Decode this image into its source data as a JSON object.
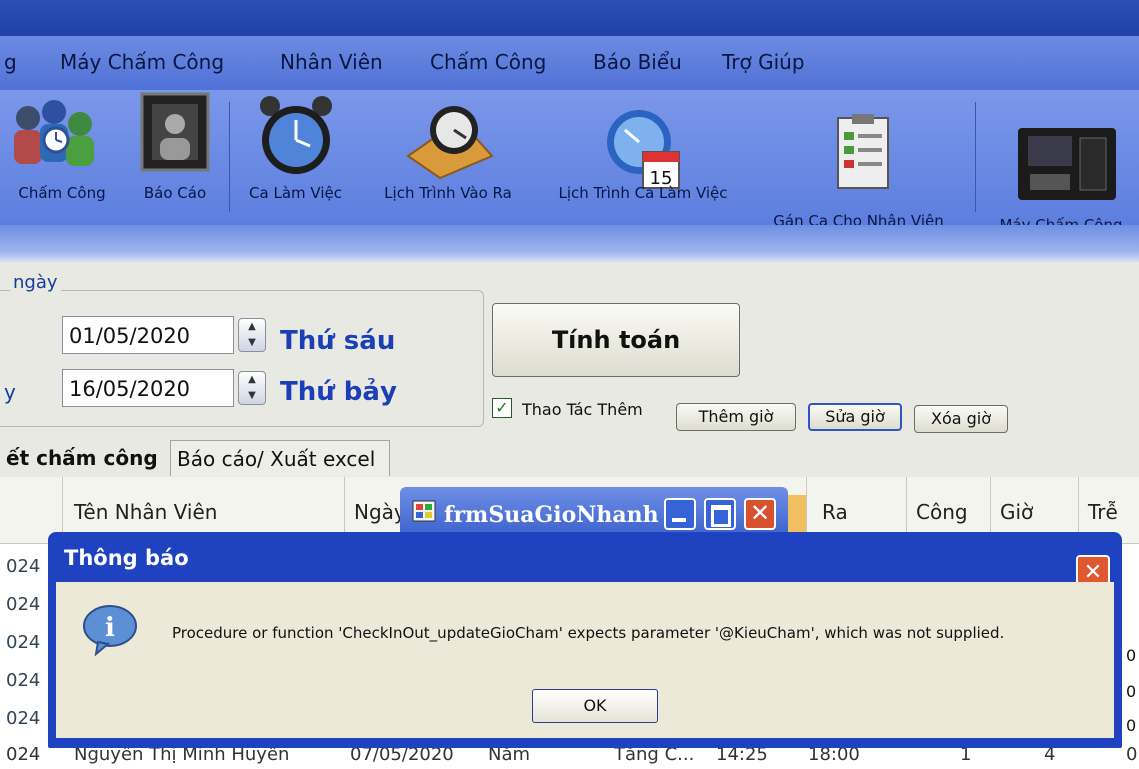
{
  "menu": [
    "g",
    "Máy Chấm Công",
    "Nhân Viên",
    "Chấm Công",
    "Báo Biểu",
    "Trợ Giúp"
  ],
  "toolbar": {
    "items": [
      {
        "label": "Chấm Công",
        "icon": "people-clock-icon"
      },
      {
        "label": "Báo Cáo",
        "icon": "report-photo-icon"
      },
      {
        "label": "Ca Làm Việc",
        "icon": "alarm-clock-icon"
      },
      {
        "label": "Lịch Trình Vào Ra",
        "icon": "clock-schedule-icon"
      },
      {
        "label": "Lịch Trình Ca Làm Việc",
        "icon": "calendar-clock-icon"
      },
      {
        "label": "Gán Ca Cho Nhân Viên",
        "icon": "clipboard-icon"
      },
      {
        "label": "Máy Chấm Công",
        "icon": "attendance-machine-icon"
      }
    ]
  },
  "date_group": {
    "legend": "ngày",
    "from_date": "01/05/2020",
    "from_day": "Thứ sáu",
    "to_label": "y",
    "to_date": "16/05/2020",
    "to_day": "Thứ bảy"
  },
  "actions": {
    "calculate": "Tính toán",
    "extra_ops_label": "Thao Tác Thêm",
    "extra_ops_checked": true,
    "add_time": "Thêm giờ",
    "edit_time": "Sửa giờ",
    "delete_time": "Xóa giờ"
  },
  "tabs": [
    "ết chấm công",
    "Báo cáo/ Xuất excel"
  ],
  "grid": {
    "columns": [
      "Tên Nhân Viên",
      "Ngày",
      "Ra",
      "Công",
      "Giờ",
      "Trễ"
    ],
    "row_prefixes": [
      "024",
      "024",
      "024",
      "024",
      "024",
      "024"
    ],
    "last_row": {
      "prefix": "024",
      "name": "Nguyễn Thị Minh Huyền",
      "date": "07/05/2020",
      "weekday": "Năm",
      "shift": "Tăng C...",
      "in": "14:25",
      "out": "18:00",
      "cong": "1",
      "gio": "4",
      "tre": "0"
    },
    "right_edge_values": [
      "0",
      "0",
      "0",
      "0"
    ]
  },
  "mini_window": {
    "title": "frmSuaGioNhanh"
  },
  "dialog": {
    "title": "Thông báo",
    "message": "Procedure or function 'CheckInOut_updateGioCham' expects parameter '@KieuCham', which was not supplied.",
    "ok": "OK"
  }
}
